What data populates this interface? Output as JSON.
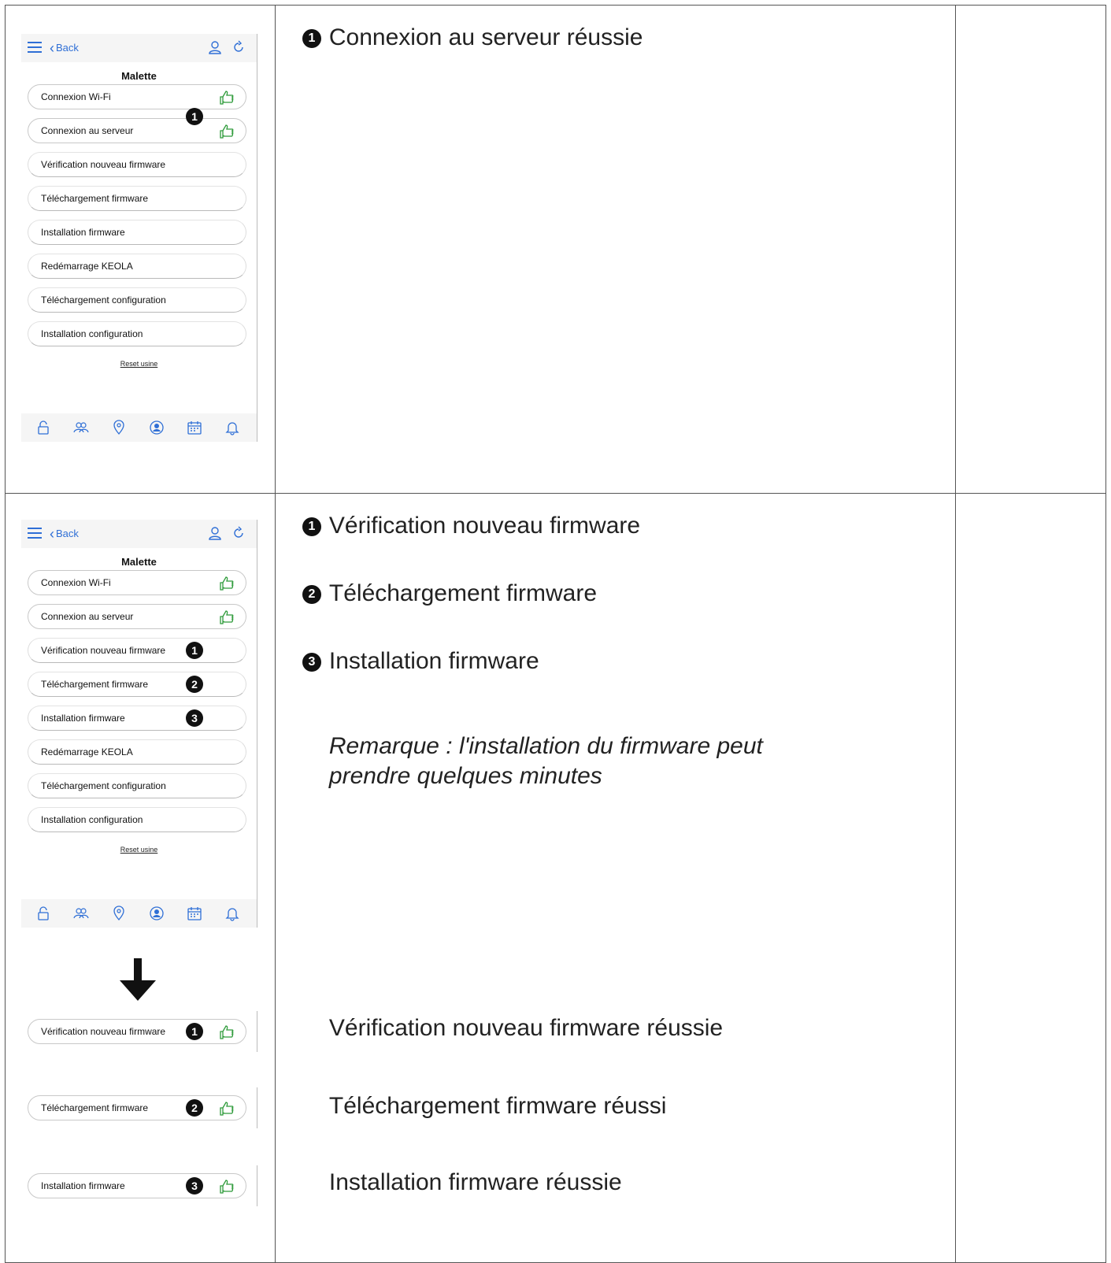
{
  "phone": {
    "back_label": "Back",
    "title": "Malette",
    "reset_label": "Reset usine",
    "items": [
      "Connexion Wi-Fi",
      "Connexion au serveur",
      "Vérification nouveau firmware",
      "Téléchargement firmware",
      "Installation firmware",
      "Redémarrage KEOLA",
      "Téléchargement configuration",
      "Installation configuration"
    ],
    "tab_icons": [
      "lock-icon",
      "users-icon",
      "location-icon",
      "profile-icon",
      "calendar-icon",
      "bell-icon"
    ],
    "accent_color": "#2f6fd6",
    "success_color": "#2e9b3a"
  },
  "row1": {
    "badge": "1",
    "note": "Connexion au serveur réussie"
  },
  "row2": {
    "badges": [
      "1",
      "2",
      "3"
    ],
    "notes": [
      "Vérification nouveau firmware",
      "Téléchargement firmware",
      "Installation firmware"
    ],
    "remark": "Remarque : l'installation du firmware peut prendre quelques minutes",
    "results": [
      "Vérification nouveau firmware réussie",
      "Téléchargement firmware réussi",
      "Installation firmware réussie"
    ]
  }
}
